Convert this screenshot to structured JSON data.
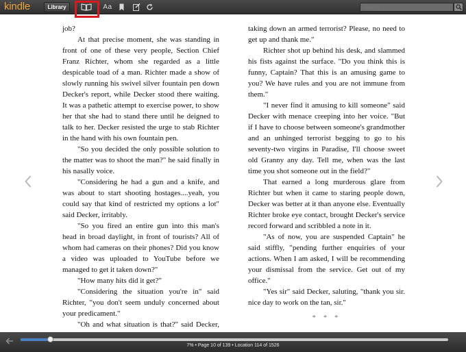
{
  "app": {
    "logo": "kindle"
  },
  "toolbar": {
    "library_label": "Library",
    "font_label": "Aa",
    "search_placeholder": "Search"
  },
  "book": {
    "left_column": [
      {
        "text": "job?",
        "indent": false
      },
      {
        "text": "At that precise moment, she was standing in front of one of these very people, Section Chief Franz Richter, whom she regarded as a little despicable toad of a man. Richter made a show of slowly running his swivel silver fountain pen down Decker's report, while Decker stood there waiting. It was a pathetic attempt to exercise power, to show her that she had to stand there until he deigned to talk to her. Decker resisted the urge to stab Richter in the hand with his own fountain pen.",
        "indent": true
      },
      {
        "text": "\"So you decided the only possible solution to the matter was to shoot the man?\" he said finally in his nasally voice.",
        "indent": true
      },
      {
        "text": "\"Considering he had a gun and a knife, and was about to start shooting hostages....yeah, you could say that kind of restricted my options a lot\" said Decker, irritably.",
        "indent": true
      },
      {
        "text": "\"So you fired an entire gun into this man's head in broad daylight, in front of tourists? All of whom had cameras on their phones? Did you know a video was uploaded to YouTube before we managed to get it taken down?\"",
        "indent": true
      },
      {
        "text": "\"How many hits did it get?\"",
        "indent": true
      },
      {
        "text": "\"Considering the situation you're in\" said Richter, \"you don't seem unduly concerned about your predicament.\"",
        "indent": true
      },
      {
        "text": "\"Oh and what situation is that?\" said Decker, \"saving the lives of civilians? Decisively",
        "indent": true
      }
    ],
    "right_column": [
      {
        "text": "taking down an armed terrorist? Please, no need to get up and thank me.\"",
        "indent": false
      },
      {
        "text": "Richter shot up behind his desk, and slammed his fists against the surface. \"Do you think this is funny, Captain? That this is an amusing game to you? We have rules and you are not immune from them.\"",
        "indent": true
      },
      {
        "text": "\"I never find it amusing to kill someone\" said Decker with menace creeping into her voice. \"But if I have to choose between someone's grandmother and an unhinged terrorist begging to go to his seventy-two virgins in Paradise, I'll choose sweet old Granny any day. Tell me, when was the last time you shot someone out in the field?\"",
        "indent": true
      },
      {
        "text": "That earned a long murderous glare from Richter but when it came to staring people down, Decker was better at it than anyone else. Eventually Richter broke eye contact, brought Decker's service record forward and scribbled a note in it.",
        "indent": true
      },
      {
        "text": "\"As of now, you are suspended Captain\" he said stiffly, \"pending further enquiries of your actions. When I am asked, I will be recommending your dismissal from the service. Get out of my office.\"",
        "indent": true
      },
      {
        "text": "\"Yes sir\" said Decker, saluting, \"thank you sir. nice day to work on the tan, sir.\"",
        "indent": true
      }
    ],
    "scene_break": "* * *"
  },
  "footer": {
    "location_text": "7% • Page 10 of 139 • Location 114 of 1526",
    "progress_fraction": 0.07
  },
  "colors": {
    "logo": "#f0a436",
    "progress": "#4b7fc4",
    "highlight": "#d8191d"
  }
}
